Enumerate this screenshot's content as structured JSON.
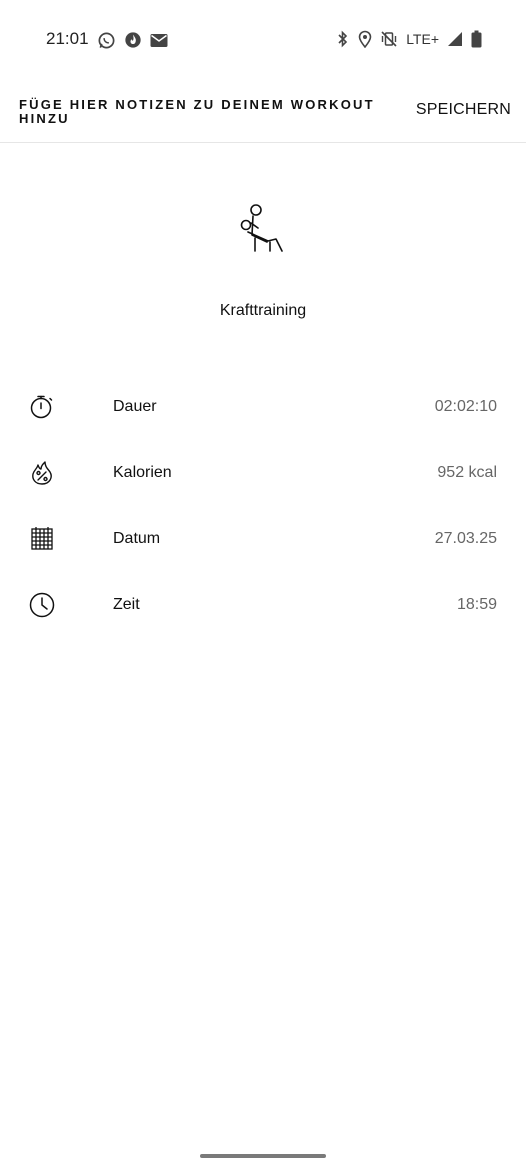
{
  "status_bar": {
    "time": "21:01",
    "left_icons": [
      "whatsapp-icon",
      "fire-icon",
      "mail-icon"
    ],
    "network": "LTE+",
    "right_icons": [
      "bluetooth-icon",
      "location-icon",
      "vibrate-off-icon",
      "signal-icon",
      "battery-icon"
    ]
  },
  "header": {
    "title": "FÜGE HIER NOTIZEN ZU DEINEM WORKOUT HINZU",
    "save_label": "SPEICHERN"
  },
  "activity": {
    "icon": "strength-training-icon",
    "name": "Krafttraining"
  },
  "stats": [
    {
      "icon": "stopwatch-icon",
      "label": "Dauer",
      "value": "02:02:10"
    },
    {
      "icon": "calories-flame-icon",
      "label": "Kalorien",
      "value": "952 kcal"
    },
    {
      "icon": "calendar-icon",
      "label": "Datum",
      "value": "27.03.25"
    },
    {
      "icon": "clock-icon",
      "label": "Zeit",
      "value": "18:59"
    }
  ]
}
